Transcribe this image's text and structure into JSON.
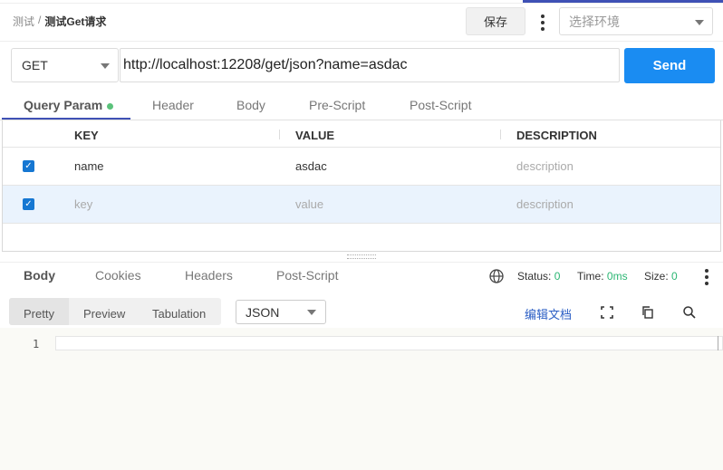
{
  "header": {
    "breadcrumb_parent": "测试",
    "breadcrumb_sep": "/",
    "breadcrumb_current": "测试Get请求",
    "save_label": "保存",
    "env_placeholder": "选择环境"
  },
  "request": {
    "method": "GET",
    "url": "http://localhost:12208/get/json?name=asdac",
    "send_label": "Send",
    "tabs": [
      {
        "label": "Query Param",
        "active": true,
        "has_dot": true
      },
      {
        "label": "Header"
      },
      {
        "label": "Body"
      },
      {
        "label": "Pre-Script"
      },
      {
        "label": "Post-Script"
      }
    ]
  },
  "params": {
    "columns": [
      "KEY",
      "VALUE",
      "DESCRIPTION"
    ],
    "rows": [
      {
        "checked": true,
        "key": "name",
        "value": "asdac",
        "description": "description"
      },
      {
        "checked": true,
        "key": "key",
        "value": "value",
        "description": "description",
        "placeholder": true
      }
    ]
  },
  "response": {
    "tabs": [
      {
        "label": "Body",
        "active": true
      },
      {
        "label": "Cookies"
      },
      {
        "label": "Headers"
      },
      {
        "label": "Post-Script"
      }
    ],
    "status_label": "Status:",
    "status_value": "0",
    "time_label": "Time:",
    "time_value": "0ms",
    "size_label": "Size:",
    "size_value": "0",
    "views": [
      "Pretty",
      "Preview",
      "Tabulation"
    ],
    "active_view": "Pretty",
    "format": "JSON",
    "edit_doc_label": "编辑文档",
    "line_numbers": [
      "1"
    ]
  },
  "colors": {
    "accent": "#3f51b5",
    "send": "#1a8cf2",
    "checkbox": "#1677d2",
    "status_ok": "#2bb673",
    "link": "#2c5fc5"
  }
}
